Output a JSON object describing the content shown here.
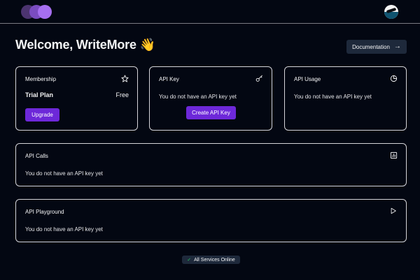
{
  "header": {
    "logo_icon": "logo-circles-icon",
    "avatar_icon": "user-avatar-icon"
  },
  "welcome": {
    "title": "Welcome, WriteMore 👋"
  },
  "documentation_button": {
    "label": "Documentation",
    "icon": "arrow-right-icon",
    "glyph": "→"
  },
  "membership_card": {
    "title": "Membership",
    "icon": "star-icon",
    "plan_name": "Trial Plan",
    "plan_price": "Free",
    "button_label": "Upgrade"
  },
  "api_key_card": {
    "title": "API Key",
    "icon": "key-icon",
    "message": "You do not have an API key yet",
    "button_label": "Create API Key"
  },
  "api_usage_card": {
    "title": "API Usage",
    "icon": "pie-chart-icon",
    "message": "You do not have an API key yet"
  },
  "api_calls_card": {
    "title": "API Calls",
    "icon": "bar-chart-icon",
    "message": "You do not have an API key yet"
  },
  "api_playground_card": {
    "title": "API Playground",
    "icon": "play-icon",
    "message": "You do not have an API key yet"
  },
  "status": {
    "label": "All Services Online",
    "icon": "check-icon",
    "glyph": "✓"
  },
  "colors": {
    "background": "#030712",
    "accent": "#6d28d9",
    "border": "#d4d4d8",
    "secondary_button": "#1e293b",
    "success": "#22c55e"
  }
}
